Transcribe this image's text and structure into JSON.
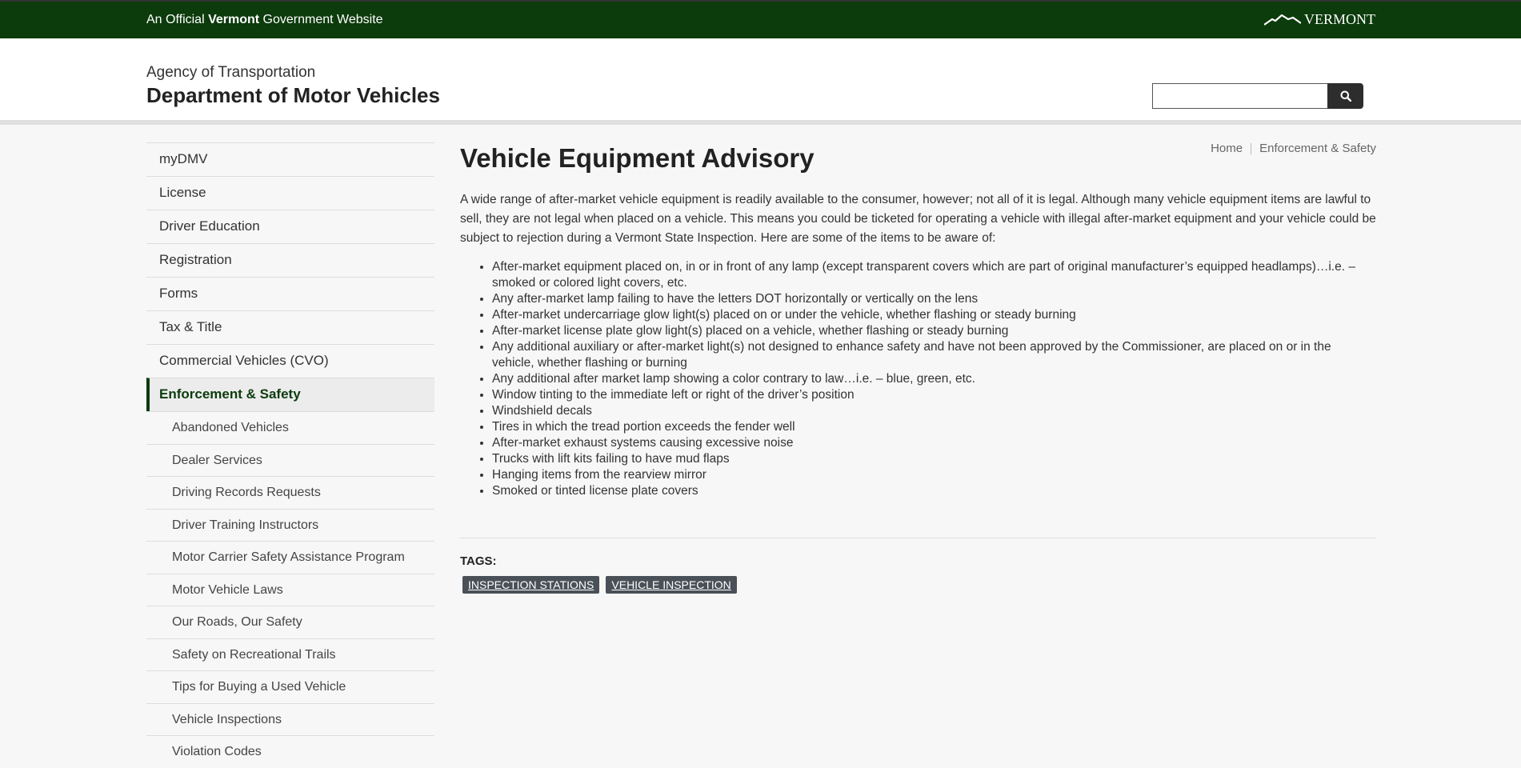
{
  "official_bar": {
    "prefix": "An Official ",
    "state": "Vermont",
    "suffix": " Government Website",
    "logo_text": "VERMONT"
  },
  "header": {
    "agency": "Agency of Transportation",
    "department": "Department of Motor Vehicles",
    "search_placeholder": ""
  },
  "sidebar": {
    "items": [
      {
        "label": "myDMV"
      },
      {
        "label": "License"
      },
      {
        "label": "Driver Education"
      },
      {
        "label": "Registration"
      },
      {
        "label": "Forms"
      },
      {
        "label": "Tax & Title"
      },
      {
        "label": "Commercial Vehicles (CVO)"
      },
      {
        "label": "Enforcement & Safety"
      }
    ],
    "sub_items": [
      {
        "label": "Abandoned Vehicles"
      },
      {
        "label": "Dealer Services"
      },
      {
        "label": "Driving Records Requests"
      },
      {
        "label": "Driver Training Instructors"
      },
      {
        "label": "Motor Carrier Safety Assistance Program"
      },
      {
        "label": "Motor Vehicle Laws"
      },
      {
        "label": "Our Roads, Our Safety"
      },
      {
        "label": "Safety on Recreational Trails"
      },
      {
        "label": "Tips for Buying a Used Vehicle"
      },
      {
        "label": "Vehicle Inspections"
      },
      {
        "label": "Violation Codes"
      }
    ]
  },
  "breadcrumb": {
    "home": "Home",
    "current": "Enforcement & Safety"
  },
  "main": {
    "title": "Vehicle Equipment Advisory",
    "intro": "A wide range of after-market vehicle equipment is readily available to the consumer, however; not all of it is legal. Although many vehicle equipment items are lawful to sell, they are not legal when placed on a vehicle. This means you could be ticketed for operating a vehicle with illegal after-market equipment and your vehicle could be subject to rejection during a Vermont State Inspection. Here are some of the items to be aware of:",
    "items": [
      "After-market equipment placed on, in or in front of any lamp (except transparent covers which are part of original manufacturer’s equipped headlamps)…i.e. – smoked or colored light covers, etc.",
      "Any after-market lamp failing to have the letters DOT horizontally or vertically on the lens",
      "After-market undercarriage glow light(s) placed on or under the vehicle, whether flashing or steady burning",
      "After-market license plate glow light(s) placed on a vehicle, whether flashing or steady burning",
      "Any additional auxiliary or after-market light(s) not designed to enhance safety and have not been approved by the Commissioner, are placed on or in the vehicle, whether flashing or burning",
      "Any additional after market lamp showing a color contrary to law…i.e. – blue, green, etc.",
      "Window tinting to the immediate left or right of the driver’s position",
      "Windshield decals",
      "Tires in which the tread portion exceeds the fender well",
      "After-market exhaust systems causing excessive noise",
      "Trucks with lift kits failing to have mud flaps",
      "Hanging items from the rearview mirror",
      "Smoked or tinted license plate covers"
    ],
    "tags_heading": "TAGS:",
    "tags": [
      "INSPECTION STATIONS",
      "VEHICLE INSPECTION"
    ]
  },
  "colors": {
    "brand_green": "#0c3b0c",
    "tag_bg": "#4a5058"
  }
}
